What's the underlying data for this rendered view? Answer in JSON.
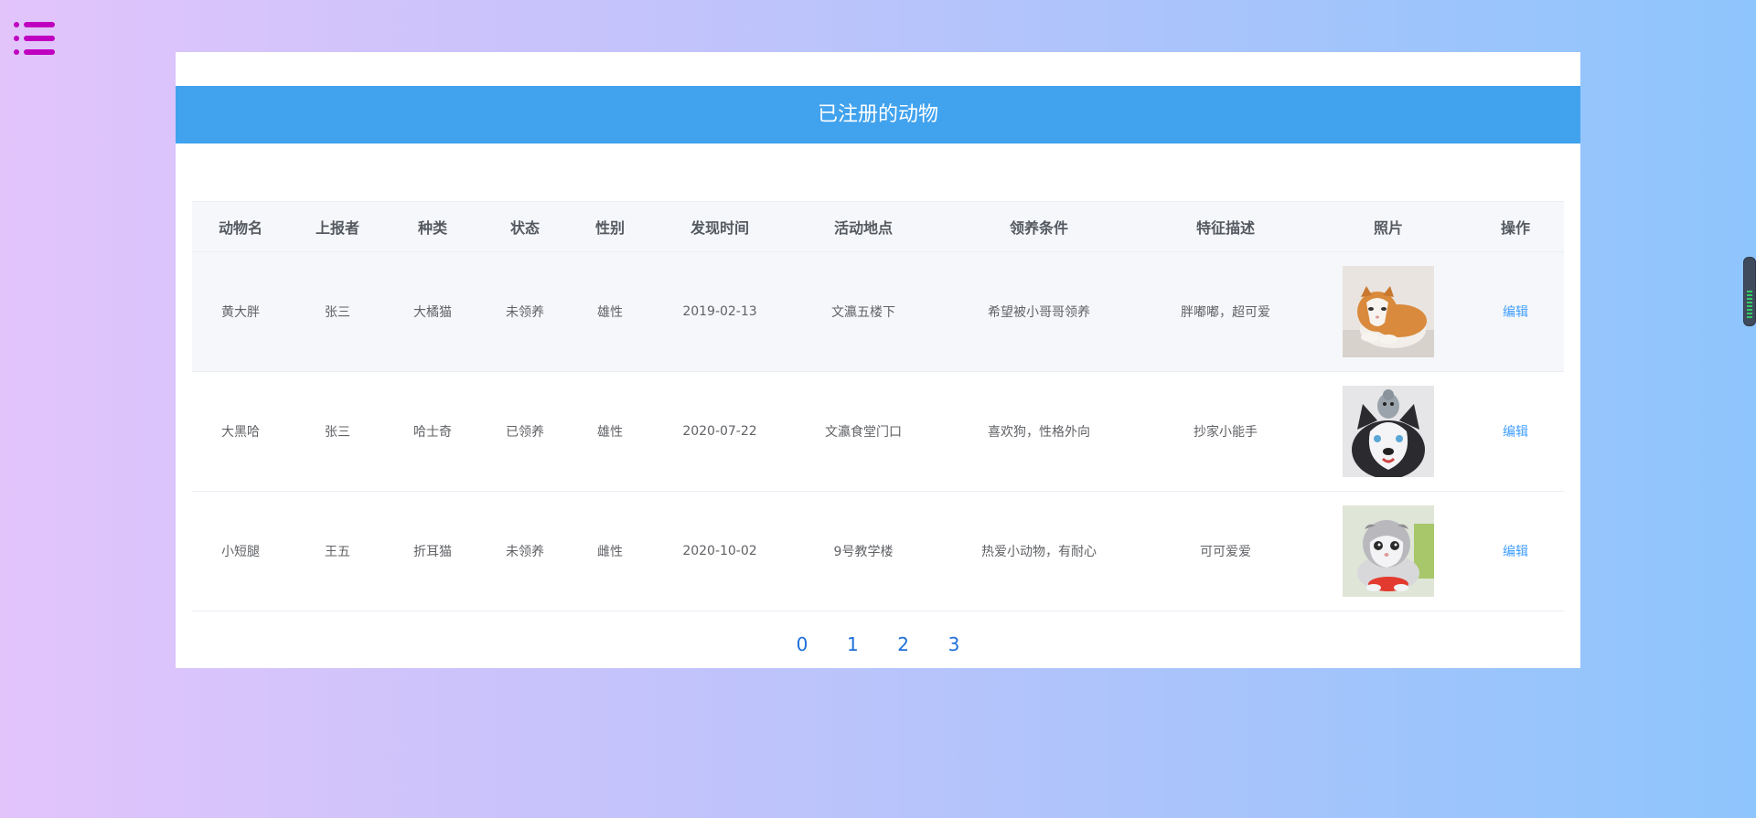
{
  "menu": {
    "icon": "list-menu-icon"
  },
  "page": {
    "title": "已注册的动物"
  },
  "table": {
    "columns": [
      "动物名",
      "上报者",
      "种类",
      "状态",
      "性别",
      "发现时间",
      "活动地点",
      "领养条件",
      "特征描述",
      "照片",
      "操作"
    ],
    "rows": [
      {
        "name": "黄大胖",
        "reporter": "张三",
        "species": "大橘猫",
        "status": "未领养",
        "gender": "雄性",
        "found_date": "2019-02-13",
        "location": "文瀛五楼下",
        "condition": "希望被小哥哥领养",
        "description": "胖嘟嘟，超可爱",
        "photo": "orange-cat-photo",
        "action": "编辑"
      },
      {
        "name": "大黑哈",
        "reporter": "张三",
        "species": "哈士奇",
        "status": "已领养",
        "gender": "雄性",
        "found_date": "2020-07-22",
        "location": "文瀛食堂门口",
        "condition": "喜欢狗，性格外向",
        "description": "抄家小能手",
        "photo": "husky-photo",
        "action": "编辑"
      },
      {
        "name": "小短腿",
        "reporter": "王五",
        "species": "折耳猫",
        "status": "未领养",
        "gender": "雌性",
        "found_date": "2020-10-02",
        "location": "9号教学楼",
        "condition": "热爱小动物，有耐心",
        "description": "可可爱爱",
        "photo": "fold-cat-photo",
        "action": "编辑"
      }
    ]
  },
  "pagination": {
    "pages": [
      "0",
      "1",
      "2",
      "3"
    ]
  },
  "colors": {
    "header_bar": "#41a2ee",
    "link": "#409eff",
    "menu_icon": "#c000c0"
  }
}
